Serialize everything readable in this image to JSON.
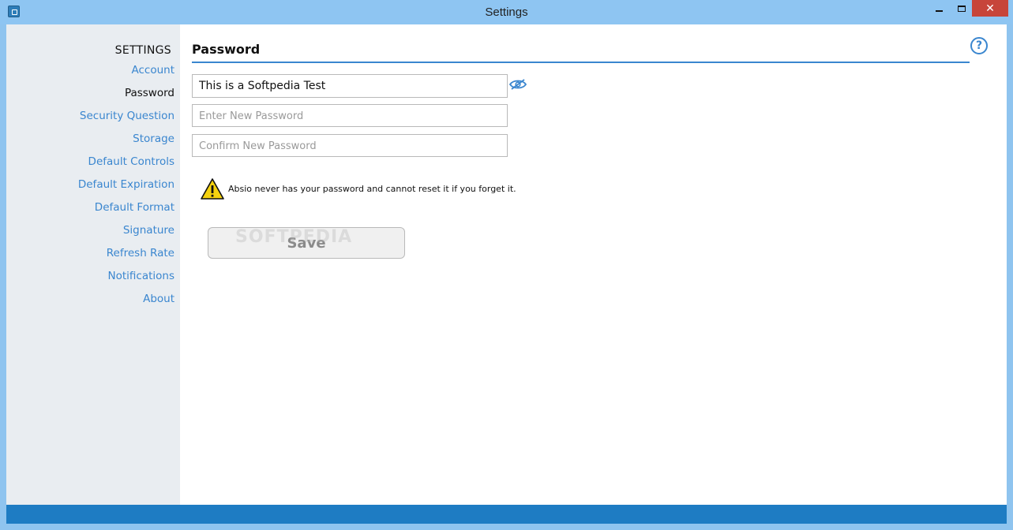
{
  "window": {
    "title": "Settings",
    "close_label": "✕"
  },
  "sidebar": {
    "title": "SETTINGS",
    "items": [
      {
        "label": "Account",
        "active": false
      },
      {
        "label": "Password",
        "active": true
      },
      {
        "label": "Security Question",
        "active": false
      },
      {
        "label": "Storage",
        "active": false
      },
      {
        "label": "Default Controls",
        "active": false
      },
      {
        "label": "Default Expiration",
        "active": false
      },
      {
        "label": "Default Format",
        "active": false
      },
      {
        "label": "Signature",
        "active": false
      },
      {
        "label": "Refresh Rate",
        "active": false
      },
      {
        "label": "Notifications",
        "active": false
      },
      {
        "label": "About",
        "active": false
      }
    ]
  },
  "main": {
    "section_title": "Password",
    "help_label": "?",
    "current_password_value": "This is a Softpedia Test",
    "new_password_placeholder": "Enter New Password",
    "confirm_password_placeholder": "Confirm New Password",
    "warning_text": "Absio never has your password and cannot reset it if you forget it.",
    "save_label": "Save",
    "watermark": "SOFTPEDIA"
  },
  "colors": {
    "accent": "#3a86cf",
    "titlebar": "#8ec5f2",
    "statusbar": "#1e7cc3",
    "sidebar_bg": "#e9edf1",
    "close_button": "#c7453a"
  }
}
